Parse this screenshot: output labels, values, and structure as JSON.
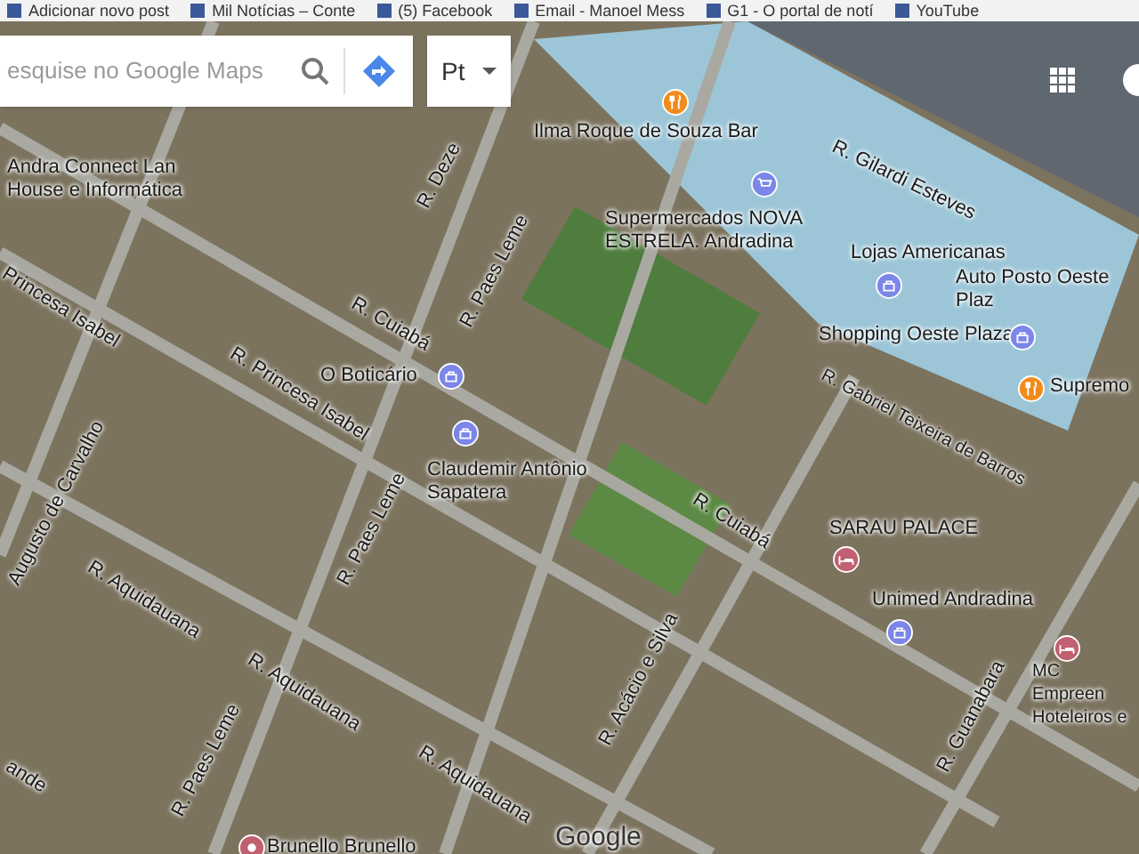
{
  "bookmarks": [
    {
      "label": "Adicionar novo post"
    },
    {
      "label": "Mil Notícias – Conte"
    },
    {
      "label": "(5) Facebook"
    },
    {
      "label": "Email - Manoel Mess"
    },
    {
      "label": "G1 - O portal de notí"
    },
    {
      "label": "YouTube"
    }
  ],
  "search": {
    "placeholder": "esquise no Google Maps"
  },
  "language": {
    "value": "Pt"
  },
  "places": [
    {
      "name": "Andra Connect Lan House e Informática",
      "kind": "label"
    },
    {
      "name": "Ilma Roque de Souza Bar",
      "kind": "restaurant"
    },
    {
      "name": "Supermercados NOVA ESTRELA. Andradina",
      "kind": "grocery"
    },
    {
      "name": "Lojas Americanas",
      "kind": "shopping"
    },
    {
      "name": "Auto Posto Oeste Plaz",
      "kind": "label"
    },
    {
      "name": "Shopping Oeste Plaza",
      "kind": "shopping"
    },
    {
      "name": "Supremo",
      "kind": "restaurant"
    },
    {
      "name": "O Boticário",
      "kind": "shopping"
    },
    {
      "name": "Claudemir Antônio Sapatera",
      "kind": "shopping"
    },
    {
      "name": "SARAU PALACE",
      "kind": "hotel"
    },
    {
      "name": "Unimed Andradina",
      "kind": "shopping"
    },
    {
      "name": "MC Empreen Hoteleiros e",
      "kind": "hotel"
    },
    {
      "name": "Brunello Brunello",
      "kind": "pin"
    }
  ],
  "streets": [
    {
      "name": "R. Deze"
    },
    {
      "name": "R. Cuiabá"
    },
    {
      "name": "R. Paes Leme"
    },
    {
      "name": "Princesa Isabel"
    },
    {
      "name": "R. Princesa Isabel"
    },
    {
      "name": "R. Gilardi Esteves"
    },
    {
      "name": "R. Gabriel Teixeira de Barros"
    },
    {
      "name": "R. Cuiabá"
    },
    {
      "name": "R. Paes Leme"
    },
    {
      "name": "R. Aquidauana"
    },
    {
      "name": "Augusto de Carvalho"
    },
    {
      "name": "R. Aquidauana"
    },
    {
      "name": "R. Aquidauana"
    },
    {
      "name": "R. Paes Leme"
    },
    {
      "name": "R. Acácio e Silva"
    },
    {
      "name": "R. Guanabara"
    },
    {
      "name": "ande"
    }
  ],
  "logo": "Google"
}
